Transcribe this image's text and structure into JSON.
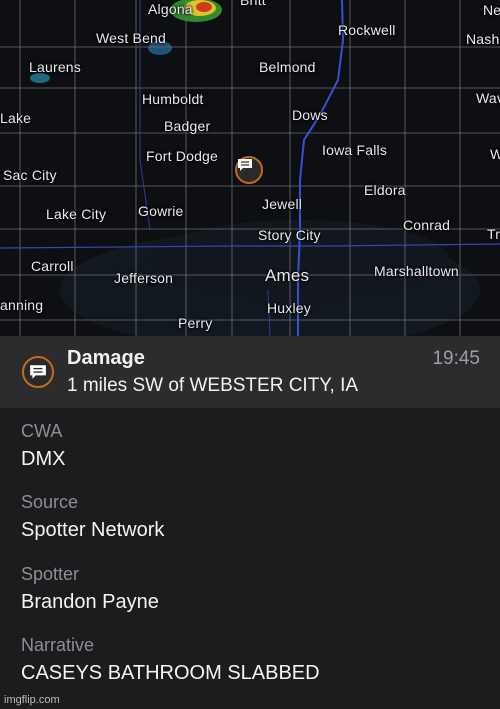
{
  "map": {
    "cities": [
      {
        "name": "Algona"
      },
      {
        "name": "Britt"
      },
      {
        "name": "West Bend"
      },
      {
        "name": "Rockwell"
      },
      {
        "name": "Nashua"
      },
      {
        "name": "Ne"
      },
      {
        "name": "Laurens"
      },
      {
        "name": "Belmond"
      },
      {
        "name": "Humboldt"
      },
      {
        "name": "Waverly"
      },
      {
        "name": "Lake"
      },
      {
        "name": "Dows"
      },
      {
        "name": "Badger"
      },
      {
        "name": "Fort Dodge"
      },
      {
        "name": "Iowa Falls"
      },
      {
        "name": "W"
      },
      {
        "name": "Sac City"
      },
      {
        "name": "Eldora"
      },
      {
        "name": "Jewell"
      },
      {
        "name": "Lake City"
      },
      {
        "name": "Gowrie"
      },
      {
        "name": "Conrad"
      },
      {
        "name": "Tr"
      },
      {
        "name": "Story City"
      },
      {
        "name": "Carroll"
      },
      {
        "name": "Jefferson"
      },
      {
        "name": "Ames"
      },
      {
        "name": "Marshalltown"
      },
      {
        "name": "anning"
      },
      {
        "name": "Huxley"
      },
      {
        "name": "Perry"
      }
    ],
    "marker_icon": "speech-bubble-icon"
  },
  "report": {
    "type": "Damage",
    "location": "1 miles SW of WEBSTER CITY, IA",
    "time": "19:45",
    "icon": "speech-bubble-icon",
    "accent_color": "#c46a1a"
  },
  "details": [
    {
      "label": "CWA",
      "value": "DMX"
    },
    {
      "label": "Source",
      "value": "Spotter Network"
    },
    {
      "label": "Spotter",
      "value": "Brandon Payne"
    },
    {
      "label": "Narrative",
      "value": "CASEYS BATHROOM SLABBED"
    }
  ],
  "watermark": "imgflip.com"
}
